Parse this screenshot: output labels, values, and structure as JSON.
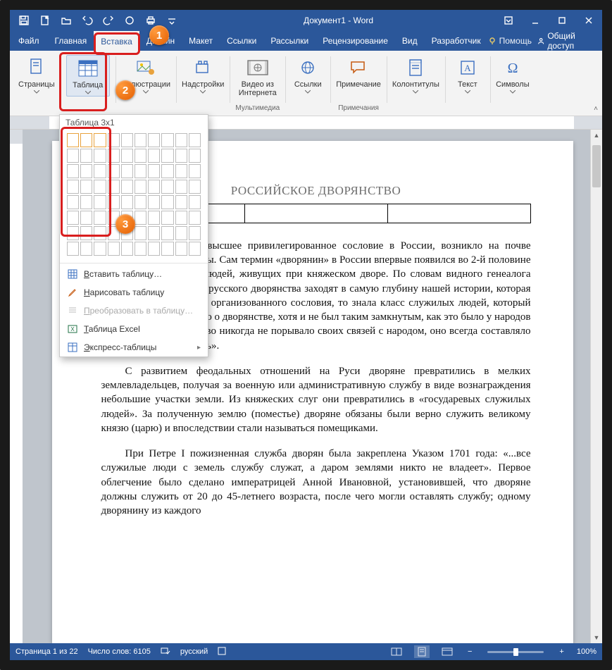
{
  "title": "Документ1 - Word",
  "qat": {
    "save": "Сохранить",
    "undo": "Отменить",
    "redo": "Повторить"
  },
  "tabs": {
    "file": "Файл",
    "home": "Главная",
    "insert": "Вставка",
    "design": "Дизайн",
    "layout": "Макет",
    "references": "Ссылки",
    "mailings": "Рассылки",
    "review": "Рецензирование",
    "view": "Вид",
    "developer": "Разработчик",
    "help": "Помощь",
    "share": "Общий доступ"
  },
  "ribbon": {
    "pages": {
      "btn": "Страницы",
      "group": ""
    },
    "table": {
      "btn": "Таблица",
      "group": ""
    },
    "illustrations": {
      "btn": "Иллюстрации",
      "group": ""
    },
    "addins": {
      "btn": "Надстройки",
      "group": ""
    },
    "video": {
      "btn": "Видео из\nИнтернета",
      "group": "Мультимедиа"
    },
    "links": {
      "btn": "Ссылки",
      "group": ""
    },
    "comment": {
      "btn": "Примечание",
      "group": "Примечания"
    },
    "headerfooter": {
      "btn": "Колонтитулы",
      "group": ""
    },
    "text": {
      "btn": "Текст",
      "group": ""
    },
    "symbols": {
      "btn": "Символы",
      "group": ""
    }
  },
  "tablePanel": {
    "title": "Таблица 3x1",
    "gridRows": 8,
    "gridCols": 10,
    "selRows": 1,
    "selCols": 3,
    "insert": "Вставить таблицу…",
    "draw": "Нарисовать таблицу",
    "convert": "Преобразовать в таблицу…",
    "excel": "Таблица Excel",
    "quick": "Экспресс-таблицы"
  },
  "document": {
    "heading": "РОССИЙСКОЕ ДВОРЯНСТВО",
    "p1": "Дворянство, как высшее привилегированное сословие в России, возникло на почве государственной службы. Сам термин «дворянин» в России впервые появился во 2-й половине XII века и обозначал людей, живущих при княжеском дворе. По словам видного генеалога Л.М. Савелова, «корни русского дворянства заходят в самую глубину нашей истории, которая если и не знала строго организованного сословия, то знала класс служилых людей, который вполне отвечал понятию о дворянстве, хотя и не был таким замкнутым, как это было у народов Запада. Наше дворянство никогда не порывало своих связей с народом, оно всегда составляло его неотъемлемую часть».",
    "p2": "С развитием феодальных отношений на Руси дворяне превратились в мелких землевладельцев, получая за военную или административную службу в виде вознаграждения небольшие участки земли. Из княжеских слуг они превратились в «государевых служилых людей». За полученную землю (поместье) дворяне обязаны были верно служить великому князю (царю) и впоследствии стали называться помещиками.",
    "p3": "При Петре I пожизненная служба дворян была закреплена Указом 1701 года: «...все служилые люди с земель службу служат, а даром землями никто не владеет». Первое облегчение было сделано императрицей Анной Ивановной, установившей, что дворяне должны служить от 20 до 45-летнего возраста, после чего могли оставлять службу; одному дворянину из каждого"
  },
  "status": {
    "page": "Страница 1 из 22",
    "words": "Число слов: 6105",
    "lang": "русский",
    "zoom": "100%"
  },
  "callouts": {
    "c1": "1",
    "c2": "2",
    "c3": "3"
  }
}
